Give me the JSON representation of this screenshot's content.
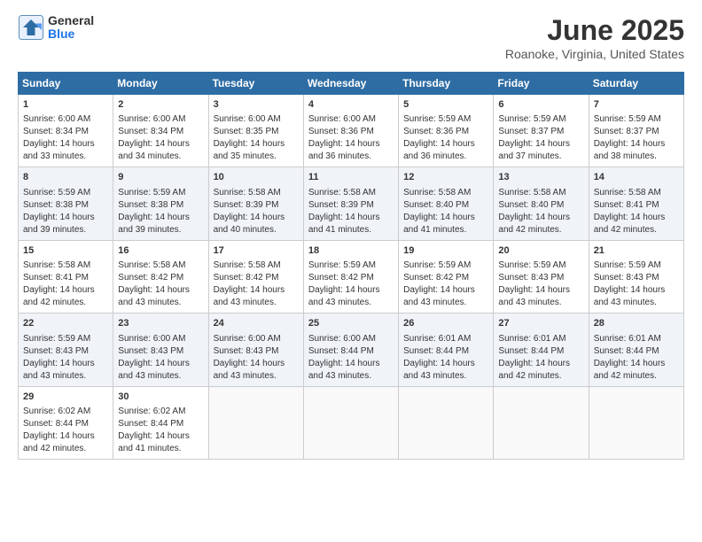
{
  "header": {
    "logo_general": "General",
    "logo_blue": "Blue",
    "month_title": "June 2025",
    "location": "Roanoke, Virginia, United States"
  },
  "calendar": {
    "days_of_week": [
      "Sunday",
      "Monday",
      "Tuesday",
      "Wednesday",
      "Thursday",
      "Friday",
      "Saturday"
    ],
    "weeks": [
      [
        {
          "day": "1",
          "sunrise": "Sunrise: 6:00 AM",
          "sunset": "Sunset: 8:34 PM",
          "daylight": "Daylight: 14 hours and 33 minutes."
        },
        {
          "day": "2",
          "sunrise": "Sunrise: 6:00 AM",
          "sunset": "Sunset: 8:34 PM",
          "daylight": "Daylight: 14 hours and 34 minutes."
        },
        {
          "day": "3",
          "sunrise": "Sunrise: 6:00 AM",
          "sunset": "Sunset: 8:35 PM",
          "daylight": "Daylight: 14 hours and 35 minutes."
        },
        {
          "day": "4",
          "sunrise": "Sunrise: 6:00 AM",
          "sunset": "Sunset: 8:36 PM",
          "daylight": "Daylight: 14 hours and 36 minutes."
        },
        {
          "day": "5",
          "sunrise": "Sunrise: 5:59 AM",
          "sunset": "Sunset: 8:36 PM",
          "daylight": "Daylight: 14 hours and 36 minutes."
        },
        {
          "day": "6",
          "sunrise": "Sunrise: 5:59 AM",
          "sunset": "Sunset: 8:37 PM",
          "daylight": "Daylight: 14 hours and 37 minutes."
        },
        {
          "day": "7",
          "sunrise": "Sunrise: 5:59 AM",
          "sunset": "Sunset: 8:37 PM",
          "daylight": "Daylight: 14 hours and 38 minutes."
        }
      ],
      [
        {
          "day": "8",
          "sunrise": "Sunrise: 5:59 AM",
          "sunset": "Sunset: 8:38 PM",
          "daylight": "Daylight: 14 hours and 39 minutes."
        },
        {
          "day": "9",
          "sunrise": "Sunrise: 5:59 AM",
          "sunset": "Sunset: 8:38 PM",
          "daylight": "Daylight: 14 hours and 39 minutes."
        },
        {
          "day": "10",
          "sunrise": "Sunrise: 5:58 AM",
          "sunset": "Sunset: 8:39 PM",
          "daylight": "Daylight: 14 hours and 40 minutes."
        },
        {
          "day": "11",
          "sunrise": "Sunrise: 5:58 AM",
          "sunset": "Sunset: 8:39 PM",
          "daylight": "Daylight: 14 hours and 41 minutes."
        },
        {
          "day": "12",
          "sunrise": "Sunrise: 5:58 AM",
          "sunset": "Sunset: 8:40 PM",
          "daylight": "Daylight: 14 hours and 41 minutes."
        },
        {
          "day": "13",
          "sunrise": "Sunrise: 5:58 AM",
          "sunset": "Sunset: 8:40 PM",
          "daylight": "Daylight: 14 hours and 42 minutes."
        },
        {
          "day": "14",
          "sunrise": "Sunrise: 5:58 AM",
          "sunset": "Sunset: 8:41 PM",
          "daylight": "Daylight: 14 hours and 42 minutes."
        }
      ],
      [
        {
          "day": "15",
          "sunrise": "Sunrise: 5:58 AM",
          "sunset": "Sunset: 8:41 PM",
          "daylight": "Daylight: 14 hours and 42 minutes."
        },
        {
          "day": "16",
          "sunrise": "Sunrise: 5:58 AM",
          "sunset": "Sunset: 8:42 PM",
          "daylight": "Daylight: 14 hours and 43 minutes."
        },
        {
          "day": "17",
          "sunrise": "Sunrise: 5:58 AM",
          "sunset": "Sunset: 8:42 PM",
          "daylight": "Daylight: 14 hours and 43 minutes."
        },
        {
          "day": "18",
          "sunrise": "Sunrise: 5:59 AM",
          "sunset": "Sunset: 8:42 PM",
          "daylight": "Daylight: 14 hours and 43 minutes."
        },
        {
          "day": "19",
          "sunrise": "Sunrise: 5:59 AM",
          "sunset": "Sunset: 8:42 PM",
          "daylight": "Daylight: 14 hours and 43 minutes."
        },
        {
          "day": "20",
          "sunrise": "Sunrise: 5:59 AM",
          "sunset": "Sunset: 8:43 PM",
          "daylight": "Daylight: 14 hours and 43 minutes."
        },
        {
          "day": "21",
          "sunrise": "Sunrise: 5:59 AM",
          "sunset": "Sunset: 8:43 PM",
          "daylight": "Daylight: 14 hours and 43 minutes."
        }
      ],
      [
        {
          "day": "22",
          "sunrise": "Sunrise: 5:59 AM",
          "sunset": "Sunset: 8:43 PM",
          "daylight": "Daylight: 14 hours and 43 minutes."
        },
        {
          "day": "23",
          "sunrise": "Sunrise: 6:00 AM",
          "sunset": "Sunset: 8:43 PM",
          "daylight": "Daylight: 14 hours and 43 minutes."
        },
        {
          "day": "24",
          "sunrise": "Sunrise: 6:00 AM",
          "sunset": "Sunset: 8:43 PM",
          "daylight": "Daylight: 14 hours and 43 minutes."
        },
        {
          "day": "25",
          "sunrise": "Sunrise: 6:00 AM",
          "sunset": "Sunset: 8:44 PM",
          "daylight": "Daylight: 14 hours and 43 minutes."
        },
        {
          "day": "26",
          "sunrise": "Sunrise: 6:01 AM",
          "sunset": "Sunset: 8:44 PM",
          "daylight": "Daylight: 14 hours and 43 minutes."
        },
        {
          "day": "27",
          "sunrise": "Sunrise: 6:01 AM",
          "sunset": "Sunset: 8:44 PM",
          "daylight": "Daylight: 14 hours and 42 minutes."
        },
        {
          "day": "28",
          "sunrise": "Sunrise: 6:01 AM",
          "sunset": "Sunset: 8:44 PM",
          "daylight": "Daylight: 14 hours and 42 minutes."
        }
      ],
      [
        {
          "day": "29",
          "sunrise": "Sunrise: 6:02 AM",
          "sunset": "Sunset: 8:44 PM",
          "daylight": "Daylight: 14 hours and 42 minutes."
        },
        {
          "day": "30",
          "sunrise": "Sunrise: 6:02 AM",
          "sunset": "Sunset: 8:44 PM",
          "daylight": "Daylight: 14 hours and 41 minutes."
        },
        {
          "day": "",
          "sunrise": "",
          "sunset": "",
          "daylight": ""
        },
        {
          "day": "",
          "sunrise": "",
          "sunset": "",
          "daylight": ""
        },
        {
          "day": "",
          "sunrise": "",
          "sunset": "",
          "daylight": ""
        },
        {
          "day": "",
          "sunrise": "",
          "sunset": "",
          "daylight": ""
        },
        {
          "day": "",
          "sunrise": "",
          "sunset": "",
          "daylight": ""
        }
      ]
    ]
  }
}
